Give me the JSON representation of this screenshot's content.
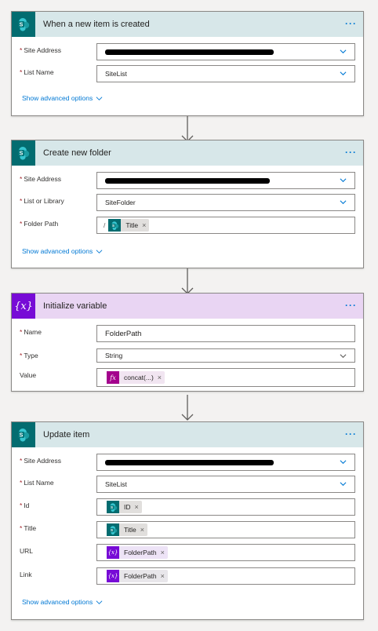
{
  "cards": {
    "c1": {
      "title": "When a new item is created",
      "site_address_label": "Site Address",
      "list_name_label": "List Name",
      "list_name_value": "SiteList",
      "advanced": "Show advanced options"
    },
    "c2": {
      "title": "Create new folder",
      "site_address_label": "Site Address",
      "library_label": "List or Library",
      "library_value": "SiteFolder",
      "folder_path_label": "Folder Path",
      "folder_path_prefix": "/",
      "folder_path_token": "Title",
      "advanced": "Show advanced options"
    },
    "c3": {
      "title": "Initialize variable",
      "icon_text": "{x}",
      "name_label": "Name",
      "name_value": "FolderPath",
      "type_label": "Type",
      "type_value": "String",
      "value_label": "Value",
      "value_token": "concat(...)",
      "fx_icon": "fx"
    },
    "c4": {
      "title": "Update item",
      "site_address_label": "Site Address",
      "list_name_label": "List Name",
      "list_name_value": "SiteList",
      "id_label": "Id",
      "id_token": "ID",
      "title_label": "Title",
      "title_token": "Title",
      "url_label": "URL",
      "url_token": "FolderPath",
      "link_label": "Link",
      "link_token": "FolderPath",
      "var_icon": "{x}",
      "advanced": "Show advanced options"
    }
  },
  "common": {
    "more": "···",
    "required": "*",
    "remove": "×"
  },
  "colors": {
    "sharepoint": "#036c70",
    "variable": "#770bd6",
    "expression": "#a4018d",
    "link": "#0078d4"
  }
}
